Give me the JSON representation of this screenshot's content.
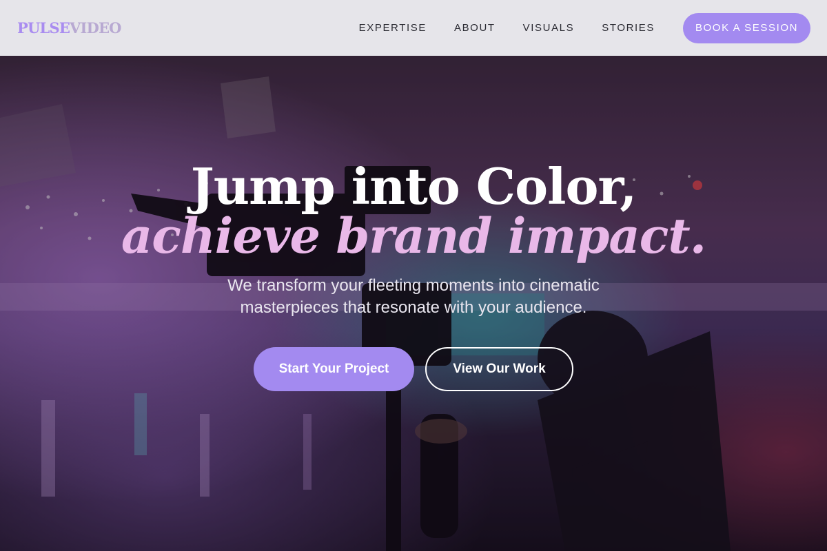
{
  "brand": {
    "part1": "PULSE",
    "part2": "VIDEO"
  },
  "nav": {
    "links": [
      {
        "label": "EXPERTISE"
      },
      {
        "label": "ABOUT"
      },
      {
        "label": "VISUALS"
      },
      {
        "label": "STORIES"
      }
    ],
    "cta_label": "BOOK A SESSION"
  },
  "hero": {
    "headline_line1": "Jump into Color,",
    "headline_line2": "achieve brand impact.",
    "subtitle": "We transform your fleeting moments into cinematic masterpieces that resonate with your audience.",
    "primary_button": "Start Your Project",
    "secondary_button": "View Our Work"
  },
  "colors": {
    "accent": "#a38af0",
    "headline_italic": "#e9b8e8",
    "navbar_bg": "#e6e5ea"
  }
}
